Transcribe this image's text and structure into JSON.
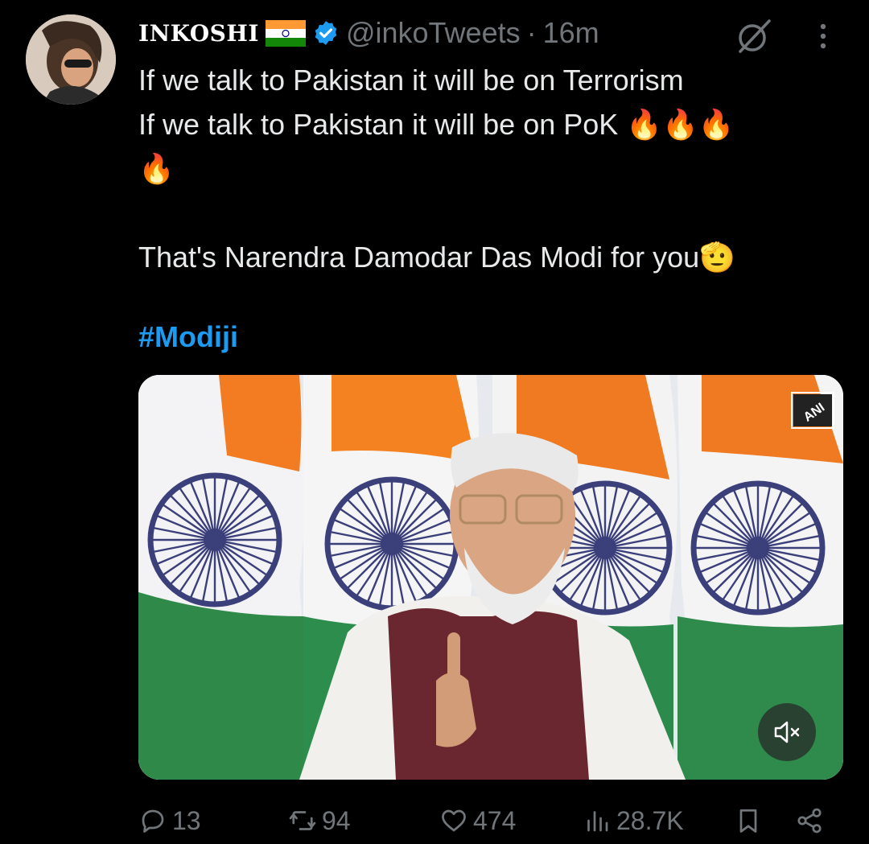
{
  "tweet": {
    "display_name": "INKOSHI",
    "handle": "@inkoTweets",
    "separator": "·",
    "time": "16m",
    "lines": [
      "If we talk to Pakistan it will be on Terrorism",
      "If we talk to Pakistan it will be on PoK 🔥🔥🔥",
      "🔥",
      "That's Narendra Damodar Das Modi for you🫡"
    ],
    "hashtag": "#Modiji",
    "media": {
      "watermark": "ANI"
    }
  },
  "actions": {
    "replies": "13",
    "reposts": "94",
    "likes": "474",
    "views": "28.7K"
  },
  "colors": {
    "background": "#000000",
    "text": "#e7e9ea",
    "muted": "#71767b",
    "accent": "#1d9bf0"
  },
  "icons": [
    "india-flag-icon",
    "verified-badge-icon",
    "grok-icon",
    "more-icon",
    "reply-icon",
    "repost-icon",
    "like-icon",
    "views-icon",
    "bookmark-icon",
    "share-icon",
    "mute-icon"
  ]
}
